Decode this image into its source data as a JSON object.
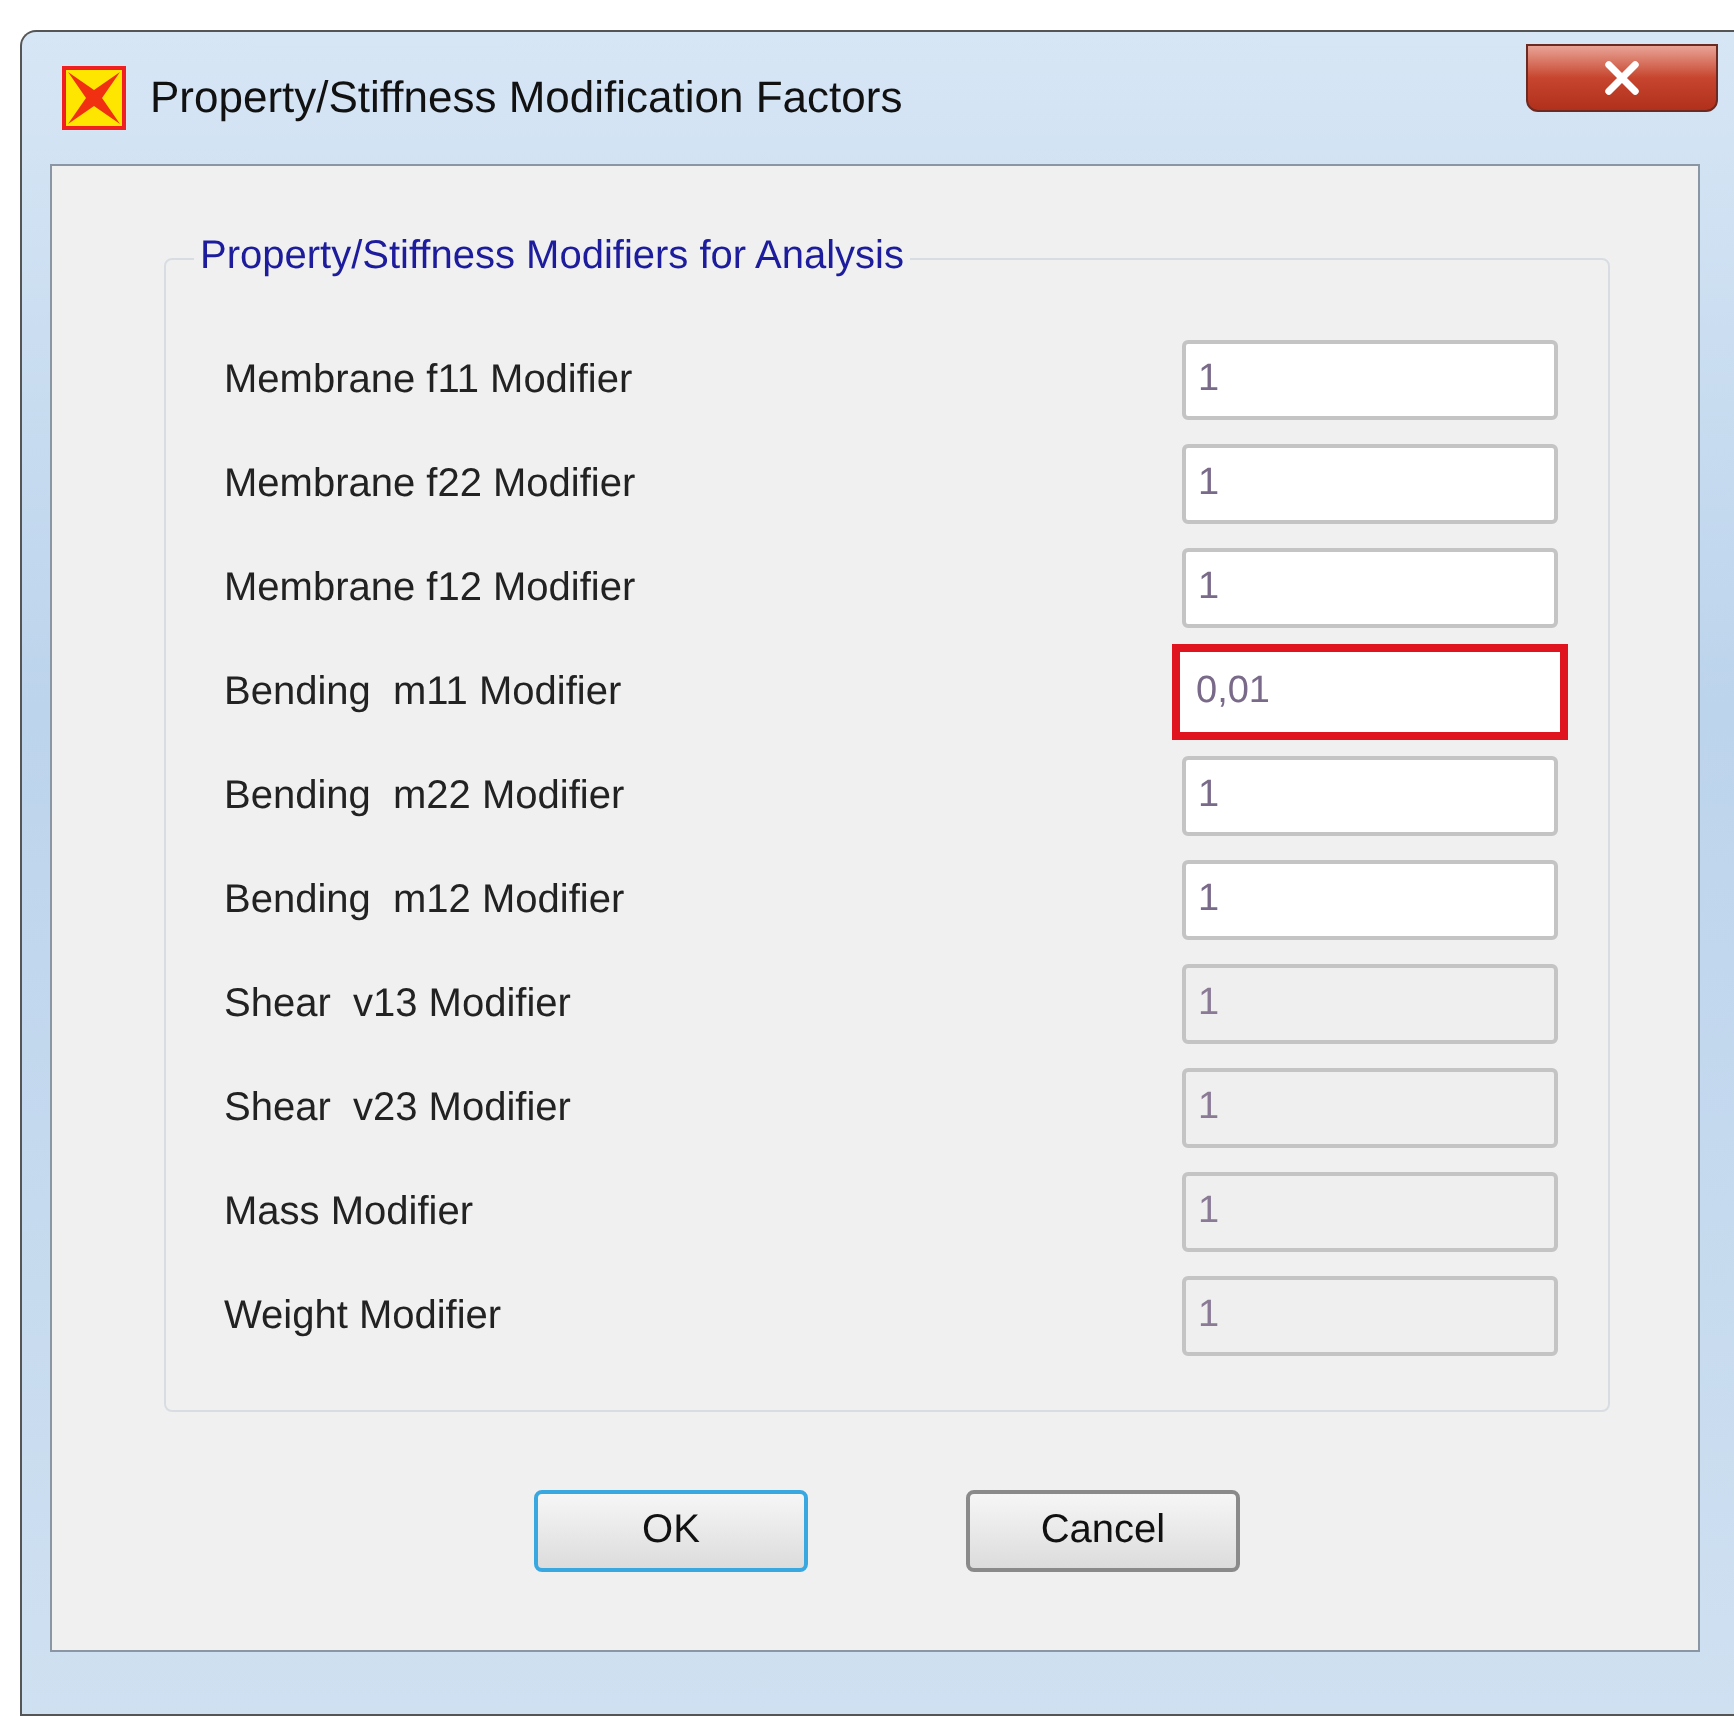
{
  "window": {
    "title": "Property/Stiffness Modification Factors"
  },
  "group": {
    "title": "Property/Stiffness Modifiers for Analysis",
    "fields": [
      {
        "label": "Membrane f11 Modifier",
        "value": "1",
        "disabled": false,
        "highlighted": false
      },
      {
        "label": "Membrane f22 Modifier",
        "value": "1",
        "disabled": false,
        "highlighted": false
      },
      {
        "label": "Membrane f12 Modifier",
        "value": "1",
        "disabled": false,
        "highlighted": false
      },
      {
        "label": "Bending  m11 Modifier",
        "value": "0,01",
        "disabled": false,
        "highlighted": true
      },
      {
        "label": "Bending  m22 Modifier",
        "value": "1",
        "disabled": false,
        "highlighted": false
      },
      {
        "label": "Bending  m12 Modifier",
        "value": "1",
        "disabled": false,
        "highlighted": false
      },
      {
        "label": "Shear  v13 Modifier",
        "value": "1",
        "disabled": true,
        "highlighted": false
      },
      {
        "label": "Shear  v23 Modifier",
        "value": "1",
        "disabled": true,
        "highlighted": false
      },
      {
        "label": "Mass Modifier",
        "value": "1",
        "disabled": true,
        "highlighted": false
      },
      {
        "label": "Weight Modifier",
        "value": "1",
        "disabled": true,
        "highlighted": false
      }
    ]
  },
  "buttons": [
    {
      "label": "OK",
      "default": true
    },
    {
      "label": "Cancel",
      "default": false
    }
  ]
}
